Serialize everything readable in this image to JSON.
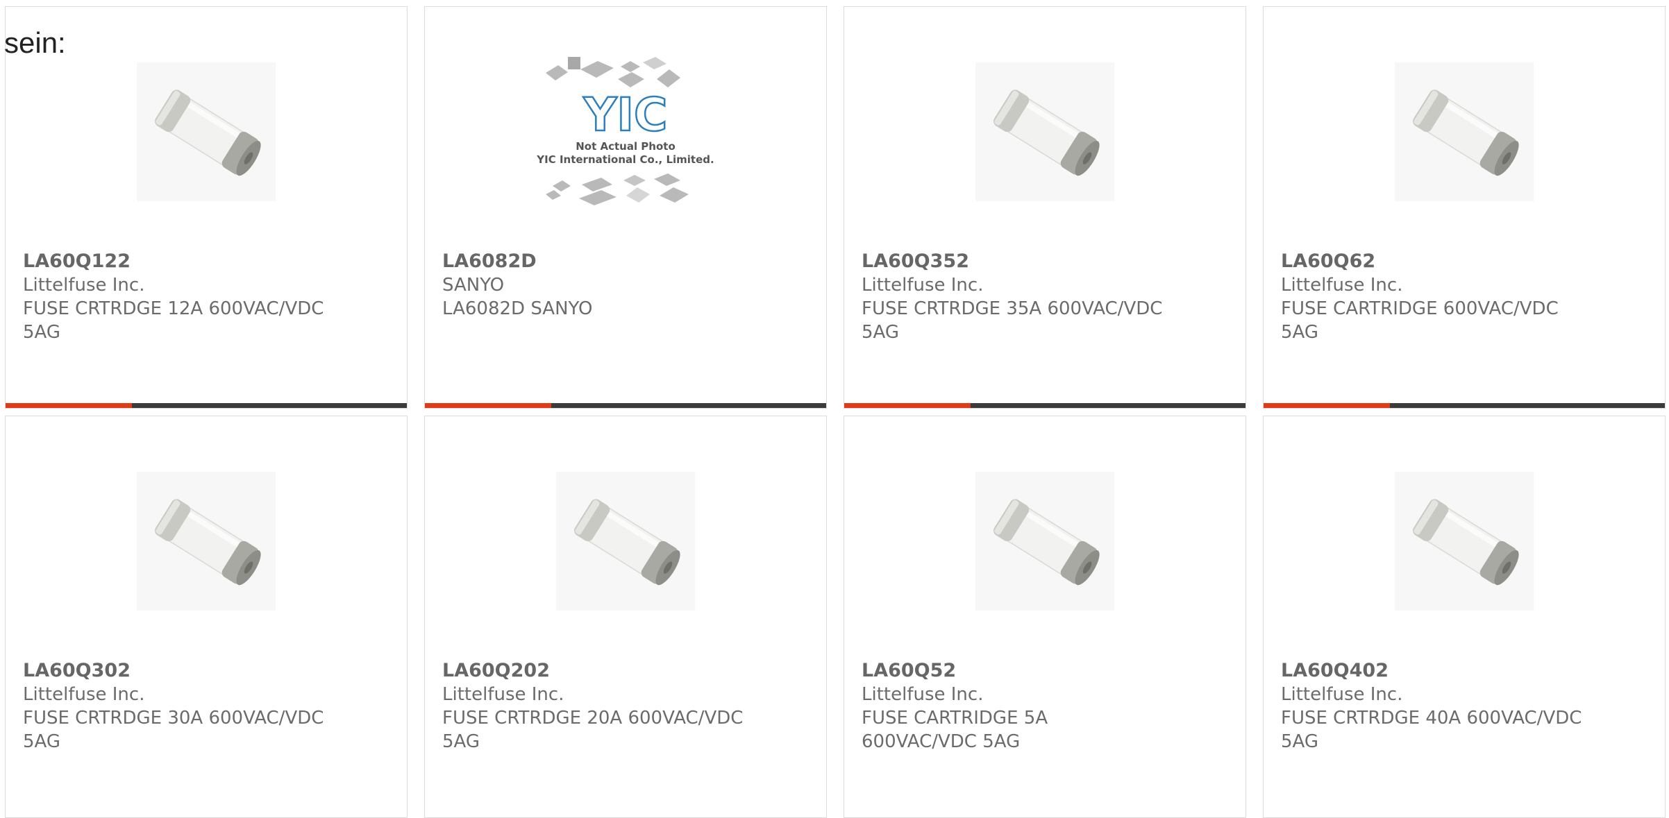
{
  "heading": "sein:",
  "colors": {
    "accent": "#e03a17",
    "bar": "#3b3b3b",
    "border": "#dcdcdc",
    "text": "#666666"
  },
  "products": [
    {
      "part": "LA60Q122",
      "manufacturer": "Littelfuse Inc.",
      "desc1": "FUSE CRTRDGE 12A 600VAC/VDC",
      "desc2": "5AG",
      "image": "fuse-photo"
    },
    {
      "part": "LA6082D",
      "manufacturer": "SANYO",
      "desc1": "LA6082D SANYO",
      "desc2": "",
      "image": "yic-placeholder-photo",
      "image_text1": "Not Actual Photo",
      "image_text2": "YIC International Co., Limited.",
      "image_logo": "YIC"
    },
    {
      "part": "LA60Q352",
      "manufacturer": "Littelfuse Inc.",
      "desc1": "FUSE CRTRDGE 35A 600VAC/VDC",
      "desc2": "5AG",
      "image": "fuse-photo"
    },
    {
      "part": "LA60Q62",
      "manufacturer": "Littelfuse Inc.",
      "desc1": "FUSE CARTRIDGE 600VAC/VDC",
      "desc2": "5AG",
      "image": "fuse-photo"
    },
    {
      "part": "LA60Q302",
      "manufacturer": "Littelfuse Inc.",
      "desc1": "FUSE CRTRDGE 30A 600VAC/VDC",
      "desc2": "5AG",
      "image": "fuse-photo"
    },
    {
      "part": "LA60Q202",
      "manufacturer": "Littelfuse Inc.",
      "desc1": "FUSE CRTRDGE 20A 600VAC/VDC",
      "desc2": "5AG",
      "image": "fuse-photo"
    },
    {
      "part": "LA60Q52",
      "manufacturer": "Littelfuse Inc.",
      "desc1": "FUSE CARTRIDGE 5A",
      "desc2": "600VAC/VDC 5AG",
      "image": "fuse-photo"
    },
    {
      "part": "LA60Q402",
      "manufacturer": "Littelfuse Inc.",
      "desc1": "FUSE CRTRDGE 40A 600VAC/VDC",
      "desc2": "5AG",
      "image": "fuse-photo"
    }
  ]
}
